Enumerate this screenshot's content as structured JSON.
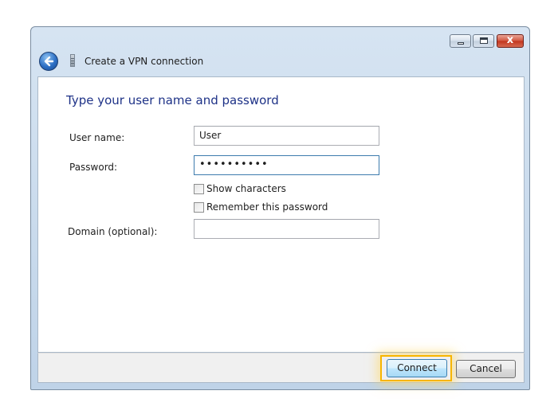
{
  "window": {
    "title": "Create a VPN connection",
    "controls": {
      "minimize": "",
      "maximize": "",
      "close": "x"
    }
  },
  "form": {
    "heading": "Type your user name and password",
    "username": {
      "label": "User name:",
      "value": "User"
    },
    "password": {
      "label": "Password:",
      "masked_value": "••••••••••"
    },
    "show_characters": {
      "label": "Show characters",
      "checked": false
    },
    "remember_password": {
      "label": "Remember this password",
      "checked": false
    },
    "domain": {
      "label": "Domain (optional):",
      "value": ""
    }
  },
  "footer": {
    "connect_label": "Connect",
    "cancel_label": "Cancel"
  },
  "colors": {
    "heading": "#1e3287",
    "highlight": "#f7b500",
    "close_button": "#c2341d"
  },
  "icons": [
    "back-arrow-icon",
    "wizard-icon",
    "minimize-icon",
    "maximize-icon",
    "close-icon"
  ]
}
